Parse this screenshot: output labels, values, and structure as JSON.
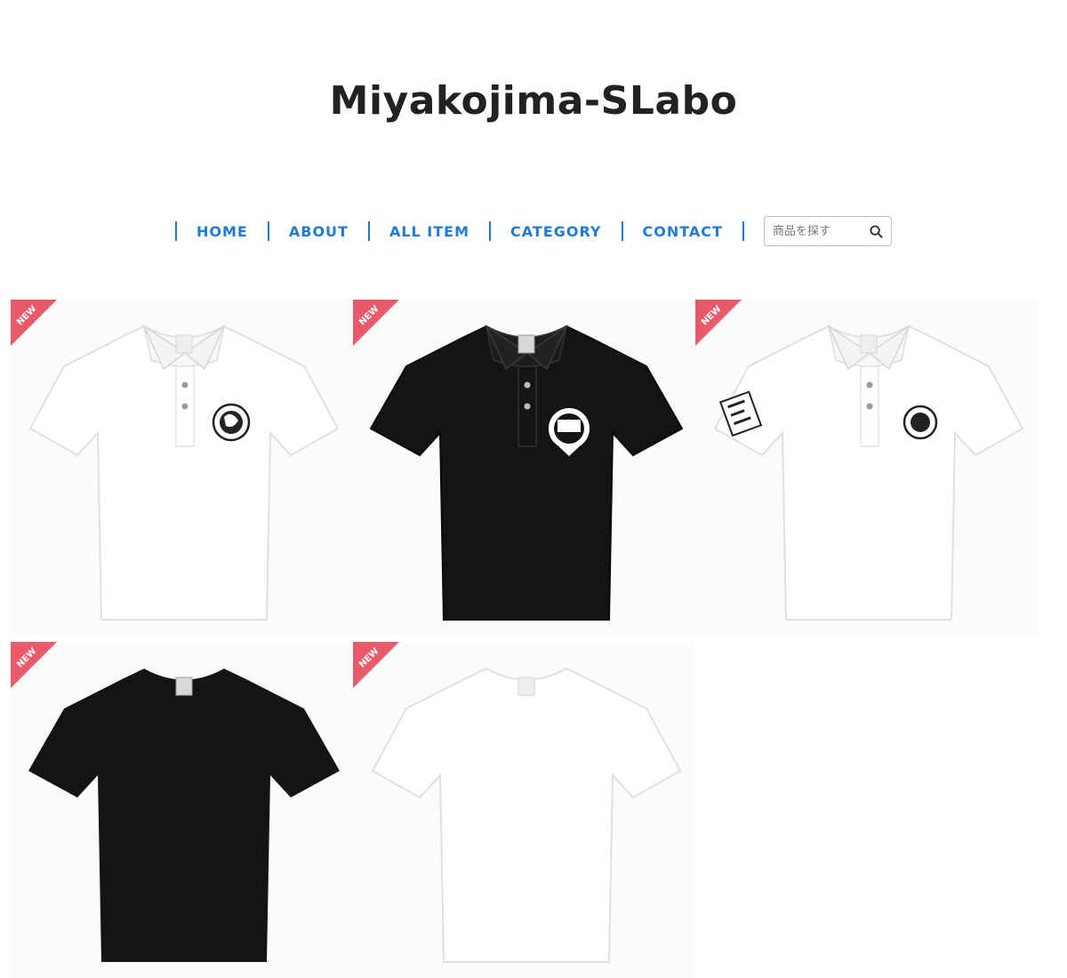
{
  "site": {
    "title": "Miyakojima-SLabo"
  },
  "nav": {
    "items": [
      {
        "label": "HOME"
      },
      {
        "label": "ABOUT"
      },
      {
        "label": "ALL ITEM"
      },
      {
        "label": "CATEGORY"
      },
      {
        "label": "CONTACT"
      }
    ],
    "link_color": "#1f7ad8"
  },
  "search": {
    "placeholder": "商品を探す",
    "value": "",
    "icon": "search-icon"
  },
  "products": [
    {
      "badge": "NEW",
      "shirt_color": "white",
      "logo": "chest-emblem"
    },
    {
      "badge": "NEW",
      "shirt_color": "black",
      "logo": "chest-emblem-44"
    },
    {
      "badge": "NEW",
      "shirt_color": "white",
      "logo": "chest-emblem-sleeve-print"
    },
    {
      "badge": "NEW",
      "shirt_color": "black",
      "logo": ""
    },
    {
      "badge": "NEW",
      "shirt_color": "white",
      "logo": ""
    }
  ],
  "colors": {
    "badge": "#e85a6a",
    "title": "#222222"
  }
}
